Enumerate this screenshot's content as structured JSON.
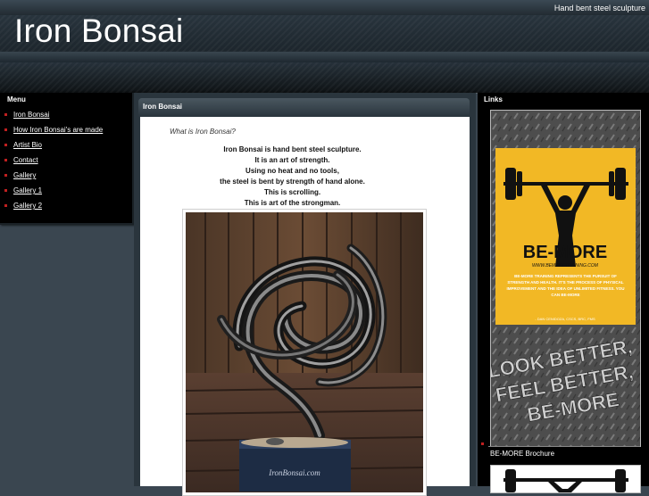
{
  "header": {
    "site_title": "Iron Bonsai",
    "tagline": "Hand bent steel sculpture"
  },
  "menu": {
    "title": "Menu",
    "items": [
      {
        "label": "Iron Bonsai"
      },
      {
        "label": "How Iron Bonsai's are made"
      },
      {
        "label": "Artist Bio"
      },
      {
        "label": "Contact"
      },
      {
        "label": "Gallery"
      },
      {
        "label": "Gallery 1"
      },
      {
        "label": "Gallery 2"
      }
    ]
  },
  "content": {
    "heading": "Iron Bonsai",
    "intro": "What is Iron Bonsai?",
    "lines": [
      "Iron Bonsai is hand bent steel sculpture.",
      "It is an art of strength.",
      "Using no heat and no tools,",
      "the steel is bent by strength of hand alone.",
      "This is scrolling.",
      "This is art of the strongman."
    ],
    "photo_watermark": "IronBonsai.com"
  },
  "links": {
    "title": "Links",
    "ad": {
      "brand": "BE-MORE",
      "url_text": "WWW.BEMORETRAINING.COM",
      "body": "BE-MORE TRAINING REPRESENTS THE PURSUIT OF STRENGTH AND HEALTH. IT'S THE PROCESS OF PHYSICAL IMPROVEMENT AND THE IDEA OF UNLIMITED FITNESS. YOU CAN BE-MORE",
      "attribution": "- DAN CENIDOZA, CSCS, BRC, FMS",
      "slogan_1": "LOOK BETTER,",
      "slogan_2": "FEEL BETTER,",
      "slogan_3": "BE-MORE"
    },
    "caption": "BE-MORE Brochure"
  },
  "colors": {
    "accent_bullet": "#c02020",
    "ad_yellow": "#f2b825",
    "page_bg": "#3a4650"
  }
}
